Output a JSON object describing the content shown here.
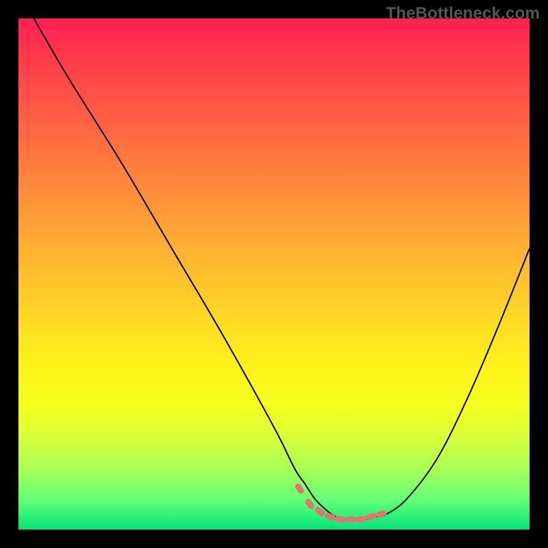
{
  "watermark": "TheBottleneck.com",
  "colors": {
    "background": "#000000",
    "curve_stroke": "#000000",
    "marker_fill": "#e0746f",
    "gradient_top": "#ff1f56",
    "gradient_bottom": "#00e878"
  },
  "chart_data": {
    "type": "line",
    "title": "",
    "xlabel": "",
    "ylabel": "",
    "xlim": [
      0,
      100
    ],
    "ylim": [
      0,
      100
    ],
    "grid": false,
    "legend": false,
    "series": [
      {
        "name": "bottleneck-curve",
        "x": [
          3,
          10,
          20,
          30,
          40,
          50,
          54,
          56,
          58,
          60,
          62,
          64,
          66,
          68,
          70,
          72,
          76,
          82,
          88,
          94,
          100
        ],
        "y": [
          100,
          88,
          72,
          55,
          38,
          20,
          12,
          9,
          6,
          4,
          2.5,
          2,
          2,
          2,
          2.5,
          3,
          6,
          14,
          26,
          40,
          55
        ]
      }
    ],
    "markers": {
      "name": "bottom-highlight",
      "x": [
        55,
        57,
        59,
        61,
        63,
        65,
        67,
        69,
        71
      ],
      "y": [
        8,
        5,
        3.5,
        2.5,
        2,
        2,
        2,
        2.5,
        3
      ]
    },
    "annotations": []
  }
}
